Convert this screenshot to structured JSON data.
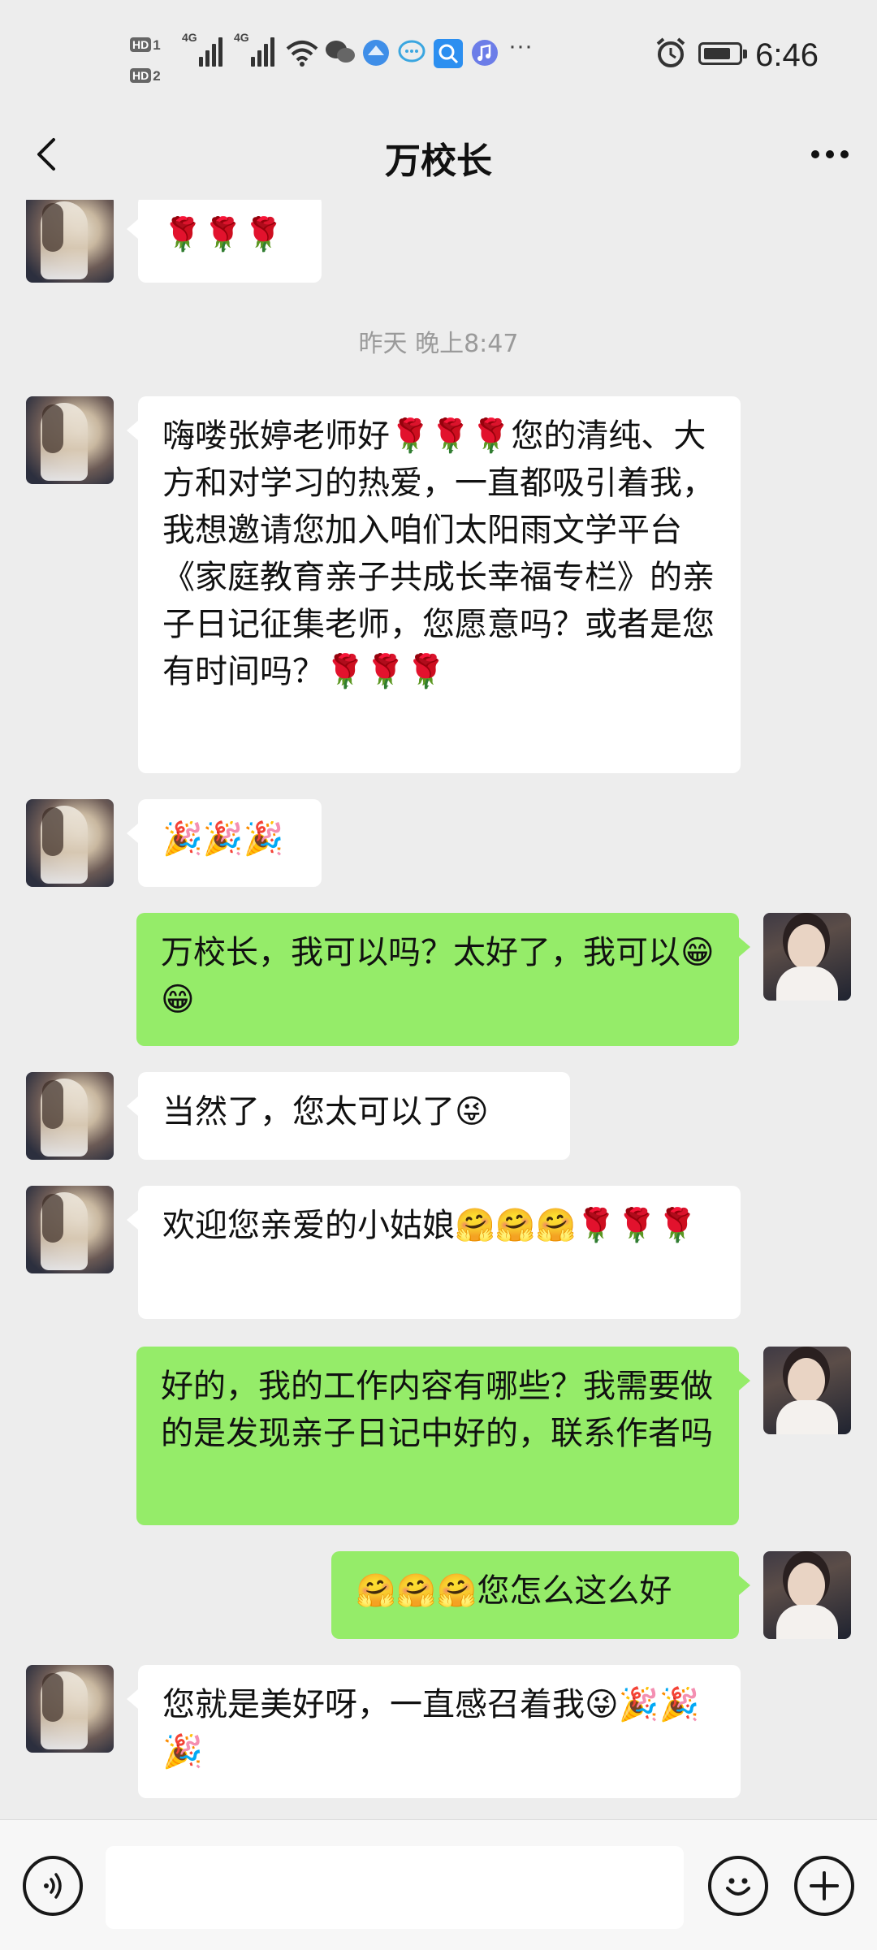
{
  "status_bar": {
    "time": "6:46",
    "hd1": "HD",
    "hd1_sub": "1",
    "hd2": "HD",
    "hd2_sub": "2",
    "net1": "4G",
    "net2": "4G",
    "more": "···",
    "battery_level": 0.8
  },
  "header": {
    "title": "万校长"
  },
  "messages": [
    {
      "side": "in",
      "text": "🌹🌹🌹"
    },
    {
      "side": "time",
      "text": "昨天 晚上8:47"
    },
    {
      "side": "in",
      "text": "嗨喽张婷老师好🌹🌹🌹您的清纯、大方和对学习的热爱，一直都吸引着我，我想邀请您加入咱们太阳雨文学平台《家庭教育亲子共成长幸福专栏》的亲子日记征集老师，您愿意吗？或者是您有时间吗？🌹🌹🌹"
    },
    {
      "side": "in",
      "text": "🎉🎉🎉"
    },
    {
      "side": "out",
      "text": "万校长，我可以吗？太好了，我可以😁😁"
    },
    {
      "side": "in",
      "text": "当然了，您太可以了😜"
    },
    {
      "side": "in",
      "text": "欢迎您亲爱的小姑娘🤗🤗🤗🌹🌹🌹"
    },
    {
      "side": "out",
      "text": "好的，我的工作内容有哪些？我需要做的是发现亲子日记中好的，联系作者吗"
    },
    {
      "side": "out",
      "text": "🤗🤗🤗您怎么这么好"
    },
    {
      "side": "in",
      "text": "您就是美好呀，一直感召着我😜🎉🎉🎉"
    }
  ],
  "colors": {
    "background": "#ededed",
    "incoming_bubble": "#ffffff",
    "outgoing_bubble": "#95ec69"
  }
}
